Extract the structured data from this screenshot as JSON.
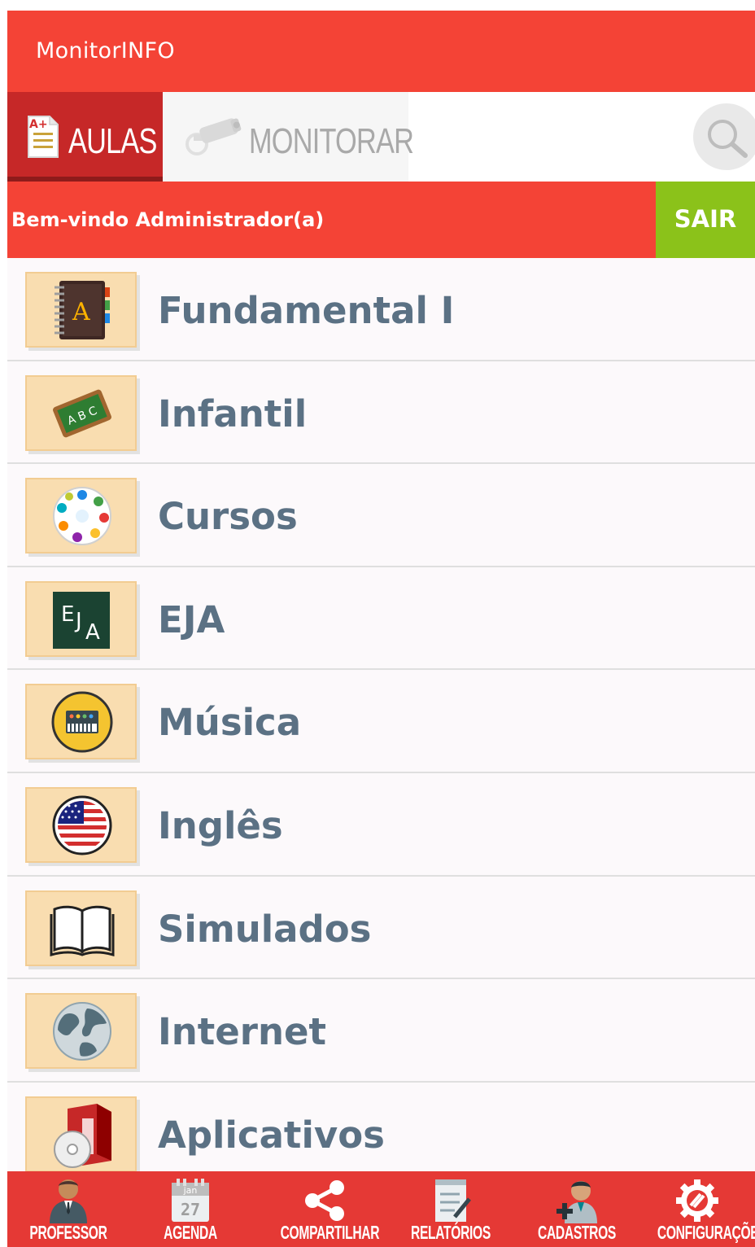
{
  "app": {
    "title": "MonitorINFO"
  },
  "tabs": [
    {
      "label": "AULAS",
      "icon": "grade-document-icon",
      "selected": true
    },
    {
      "label": "MONITORAR",
      "icon": "security-camera-icon",
      "selected": false
    }
  ],
  "search": {
    "icon": "search-icon"
  },
  "welcome": {
    "message": "Bem-vindo Administrador(a)",
    "logout_label": "SAIR"
  },
  "colors": {
    "primary": "#f44336",
    "primary_dark": "#c62828",
    "logout": "#8bc21a",
    "tile": "#f9ddb0",
    "label": "#5b7184"
  },
  "categories": [
    {
      "label": "Fundamental I",
      "icon": "address-book-icon"
    },
    {
      "label": "Infantil",
      "icon": "chalkboard-abc-icon"
    },
    {
      "label": "Cursos",
      "icon": "colored-hands-circle-icon"
    },
    {
      "label": "EJA",
      "icon": "eja-board-icon"
    },
    {
      "label": "Música",
      "icon": "synthesizer-icon"
    },
    {
      "label": "Inglês",
      "icon": "us-flag-icon"
    },
    {
      "label": "Simulados",
      "icon": "open-book-icon"
    },
    {
      "label": "Internet",
      "icon": "globe-icon"
    },
    {
      "label": "Aplicativos",
      "icon": "software-box-icon"
    }
  ],
  "bottom_nav": [
    {
      "label": "PROFESSOR",
      "icon": "teacher-icon"
    },
    {
      "label": "AGENDA",
      "icon": "calendar-icon",
      "cal_month": "jan",
      "cal_day": "27"
    },
    {
      "label": "COMPARTILHAR",
      "icon": "share-icon"
    },
    {
      "label": "RELATÓRIOS",
      "icon": "report-icon"
    },
    {
      "label": "CADASTROS",
      "icon": "add-user-icon"
    },
    {
      "label": "CONFIGURAÇÕES",
      "icon": "gear-icon"
    }
  ]
}
